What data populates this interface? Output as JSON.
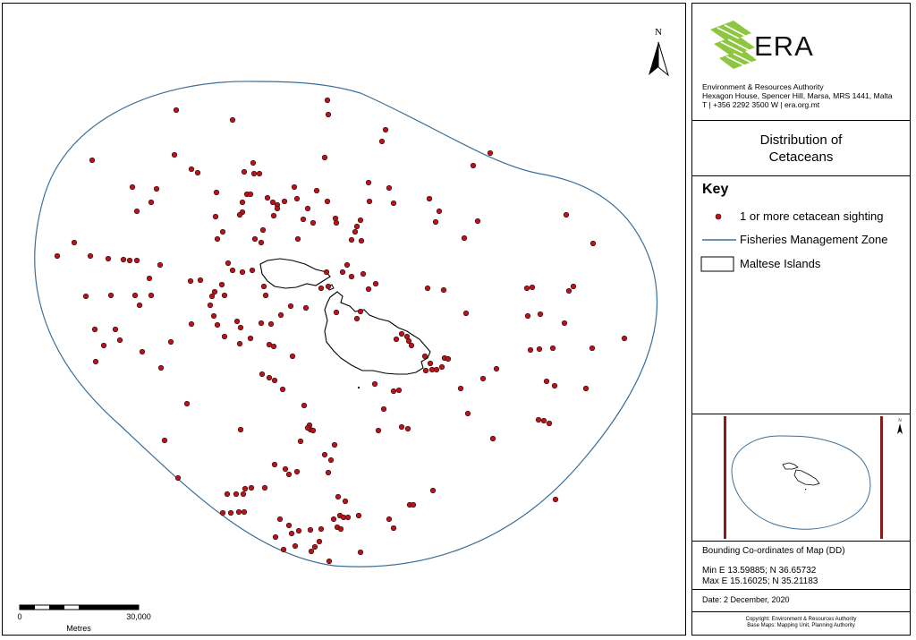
{
  "north_label": "N",
  "scale_bar": {
    "zero_label": "0",
    "end_label": "30,000",
    "units_label": "Metres"
  },
  "organisation": {
    "logo_text": "ERA",
    "name": "Environment & Resources Authority",
    "address": "Hexagon House, Spencer Hill, Marsa, MRS 1441, Malta",
    "contact": "T | +356 2292 3500  W | era.org.mt",
    "logo_color": "#8dc63f"
  },
  "map_title": {
    "line1": "Distribution of",
    "line2": "Cetaceans"
  },
  "key": {
    "heading": "Key",
    "items": [
      {
        "label": "1 or more cetacean sighting",
        "symbol": "red-dot"
      },
      {
        "label": "Fisheries Management Zone",
        "symbol": "blue-line"
      },
      {
        "label": "Maltese Islands",
        "symbol": "outline-box"
      }
    ]
  },
  "inset": {
    "north_label": "N"
  },
  "bounds": {
    "heading": "Bounding Co-ordinates of Map (DD)",
    "min_line": "Min E 13.59885; N 36.65732",
    "max_line": "Max E 15.16025; N 35.21183"
  },
  "date_text": "Date: 2 December, 2020",
  "copyright": {
    "line1": "Copyright:  Environment & Resources Authority",
    "line2": "Base Maps:  Mapping Unit, Planning Authority"
  },
  "colors": {
    "sighting_fill": "#b3161b",
    "zone_line": "#3a6f9a",
    "inset_bar": "#8b1a1a"
  }
}
